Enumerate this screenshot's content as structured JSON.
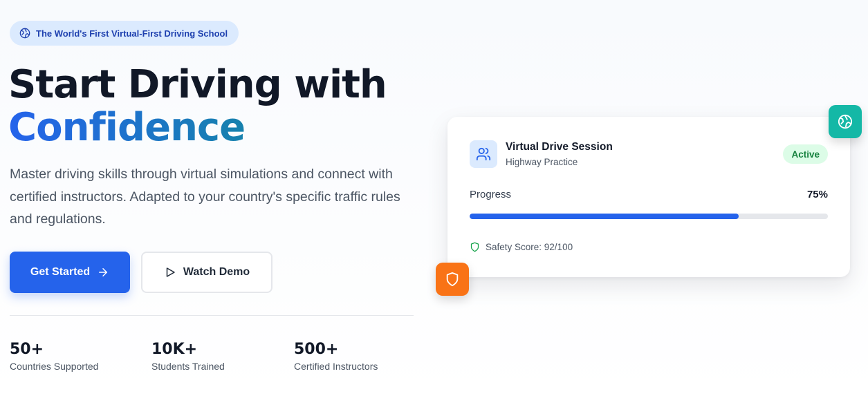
{
  "badge": {
    "icon": "globe-icon",
    "text": "The World's First Virtual-First Driving School"
  },
  "hero": {
    "title_line1": "Start Driving with",
    "title_accent": "Confidence",
    "subtitle": "Master driving skills through virtual simulations and connect with certified instructors. Adapted to your country's specific traffic rules and regulations."
  },
  "buttons": {
    "primary_label": "Get Started",
    "primary_icon": "arrow-right-icon",
    "secondary_label": "Watch Demo",
    "secondary_icon": "play-icon"
  },
  "stats": [
    {
      "value": "50+",
      "label": "Countries Supported"
    },
    {
      "value": "10K+",
      "label": "Students Trained"
    },
    {
      "value": "500+",
      "label": "Certified Instructors"
    }
  ],
  "session_card": {
    "icon": "users-icon",
    "title": "Virtual Drive Session",
    "subtitle": "Highway Practice",
    "status": "Active",
    "progress_label": "Progress",
    "progress_text": "75%",
    "progress_fraction": 0.75,
    "safety_icon": "shield-check-icon",
    "safety_text": "Safety Score: 92/100"
  },
  "floating_badges": {
    "top_right_icon": "globe-icon",
    "bottom_left_icon": "shield-icon"
  },
  "colors": {
    "primary": "#2563eb",
    "accent_teal": "#0d9488",
    "badge_bg": "#dbeafe",
    "status_green": "#15803d",
    "orange": "#f97316",
    "teal": "#14b8a6"
  }
}
